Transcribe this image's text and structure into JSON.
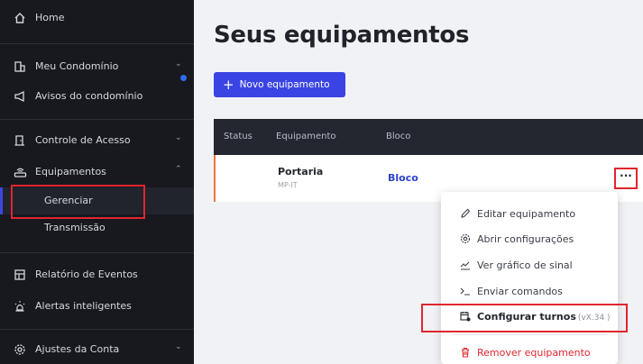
{
  "sidebar": {
    "home": "Home",
    "meu_condominio": "Meu Condomínio",
    "avisos": "Avisos do condomínio",
    "controle_acesso": "Controle de Acesso",
    "equipamentos": "Equipamentos",
    "gerenciar": "Gerenciar",
    "transmissao": "Transmissão",
    "relatorio": "Relatório de Eventos",
    "alertas": "Alertas inteligentes",
    "ajustes": "Ajustes da Conta"
  },
  "main": {
    "title": "Seus equipamentos",
    "new_button": "Novo equipamento",
    "columns": {
      "status": "Status",
      "equipamento": "Equipamento",
      "bloco": "Bloco"
    },
    "row": {
      "name": "Portaria",
      "model": "MP-IT",
      "bloco": "Bloco"
    },
    "more": "···"
  },
  "menu": {
    "editar": "Editar equipamento",
    "abrir": "Abrir configurações",
    "ver_grafico": "Ver gráfico de sinal",
    "enviar": "Enviar comandos",
    "configurar": "Configurar turnos",
    "configurar_version": "(vX.34 )",
    "remover": "Remover equipamento"
  },
  "colors": {
    "sidebar_bg": "#17191f",
    "accent": "#3a44e4",
    "highlight": "#e0262e",
    "row_border": "#f2763a"
  }
}
